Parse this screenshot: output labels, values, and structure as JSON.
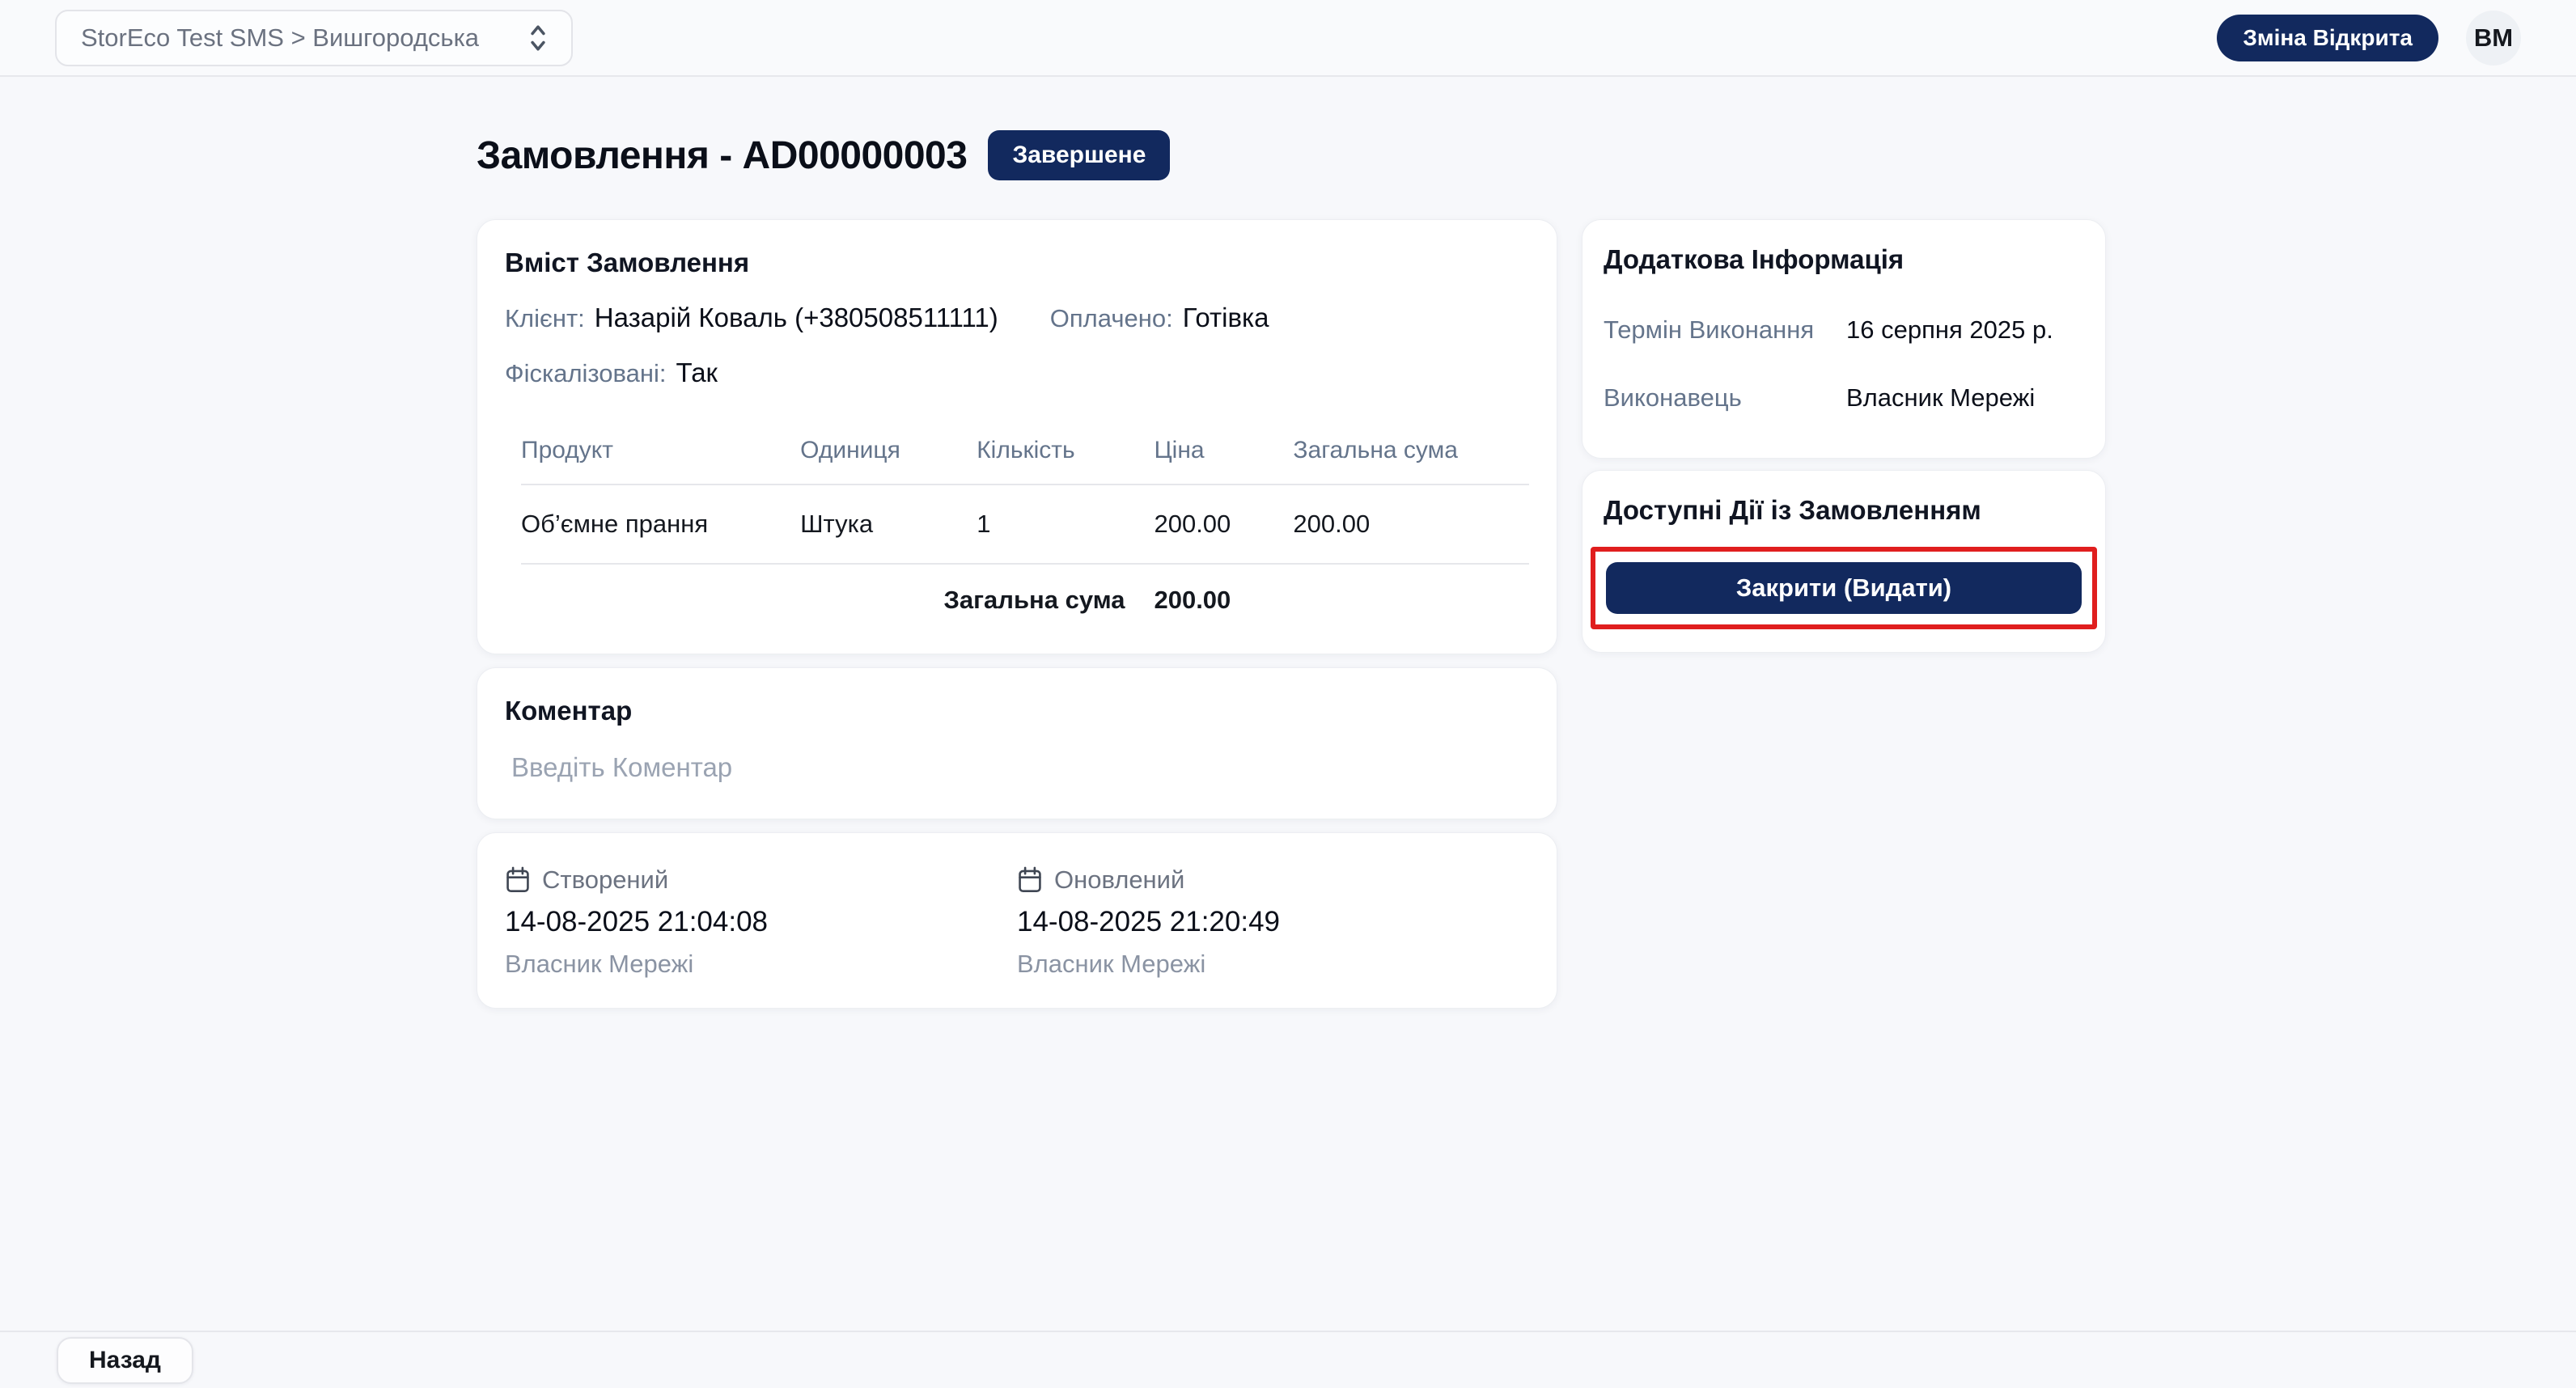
{
  "topbar": {
    "store_selector_value": "StorEco Test SMS > Вишгородська",
    "shift_badge": "Зміна Відкрита",
    "avatar_initials": "ВМ"
  },
  "page": {
    "title": "Замовлення - AD00000003",
    "status_badge": "Завершене"
  },
  "order_content": {
    "heading": "Вміст Замовлення",
    "client_label": "Клієнт:",
    "client_value": "Назарій Коваль (+380508511111)",
    "paid_label": "Оплачено:",
    "paid_value": "Готівка",
    "fiscalized_label": "Фіскалізовані:",
    "fiscalized_value": "Так",
    "table": {
      "headers": [
        "Продукт",
        "Одиниця",
        "Кількість",
        "Ціна",
        "Загальна сума"
      ],
      "rows": [
        [
          "Об’ємне прання",
          "Штука",
          "1",
          "200.00",
          "200.00"
        ]
      ],
      "total_label": "Загальна сума",
      "total_value": "200.00"
    }
  },
  "comment": {
    "heading": "Коментар",
    "placeholder": "Введіть Коментар"
  },
  "timestamps": {
    "created": {
      "label": "Створений",
      "datetime": "14-08-2025 21:04:08",
      "by": "Власник Мережі"
    },
    "updated": {
      "label": "Оновлений",
      "datetime": "14-08-2025 21:20:49",
      "by": "Власник Мережі"
    }
  },
  "additional_info": {
    "heading": "Додаткова Інформація",
    "rows": [
      {
        "label": "Термін Виконання",
        "value": "16 серпня 2025 р."
      },
      {
        "label": "Виконавець",
        "value": "Власник Мережі"
      }
    ]
  },
  "actions": {
    "heading": "Доступні Дії із Замовленням",
    "close_button": "Закрити (Видати)"
  },
  "footer": {
    "back_button": "Назад"
  },
  "colors": {
    "navy": "#12295e",
    "highlight_red": "#e01e1e",
    "page_background": "#f7f8fb",
    "label_gray": "#64748b"
  }
}
